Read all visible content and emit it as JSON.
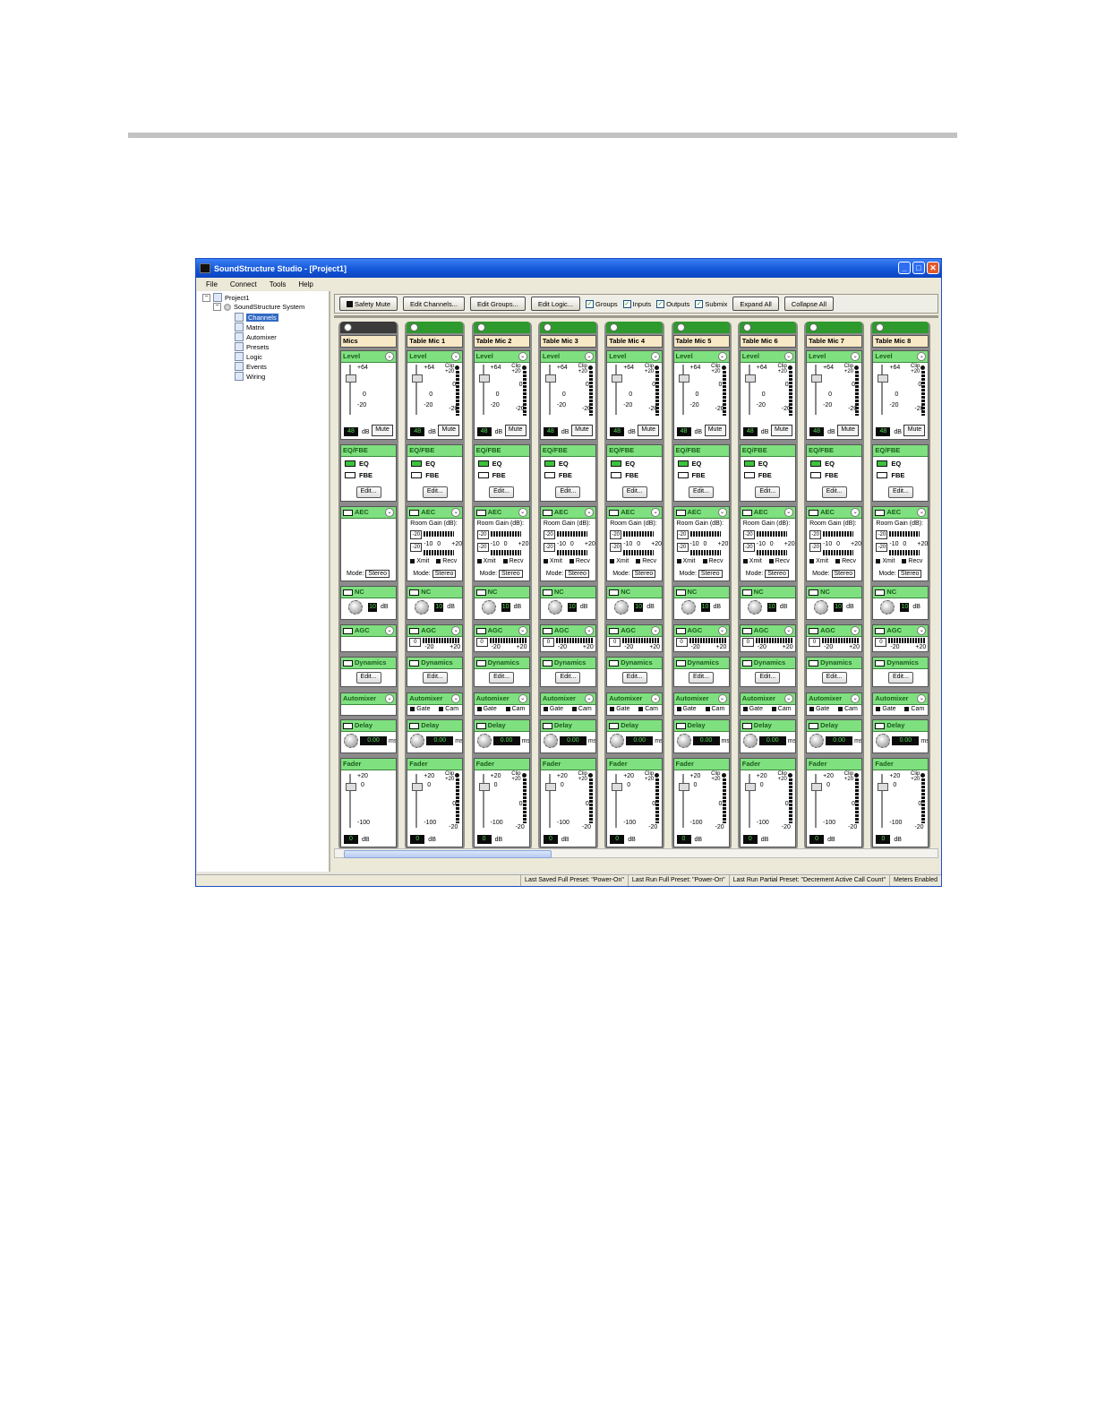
{
  "window": {
    "title": "SoundStructure Studio - [Project1]",
    "controls": [
      "_",
      "□",
      "✕"
    ]
  },
  "menu": [
    "File",
    "Connect",
    "Tools",
    "Help"
  ],
  "tree": {
    "root": "Project1",
    "system": "SoundStructure System",
    "items": [
      "Channels",
      "Matrix",
      "Automixer",
      "Presets",
      "Logic",
      "Events",
      "Wiring"
    ],
    "selected": "Channels"
  },
  "toolbar": {
    "safety_mute": "Safety Mute",
    "edit_channels": "Edit Channels...",
    "edit_groups": "Edit Groups...",
    "edit_logic": "Edit Logic...",
    "checks": [
      {
        "label": "Groups",
        "checked": true
      },
      {
        "label": "Inputs",
        "checked": true
      },
      {
        "label": "Outputs",
        "checked": true
      },
      {
        "label": "Submix",
        "checked": true
      }
    ],
    "expand_all": "Expand All",
    "collapse_all": "Collapse All"
  },
  "labels": {
    "level": "Level",
    "eqfbe": "EQ/FBE",
    "eq": "EQ",
    "fbe": "FBE",
    "edit": "Edit...",
    "aec": "AEC",
    "room_gain": "Room Gain (dB):",
    "xmit": "Xmit",
    "recv": "Recv",
    "mode": "Mode:",
    "stereo": "Stereo",
    "nc": "NC",
    "agc": "AGC",
    "dynamics": "Dynamics",
    "automixer": "Automixer",
    "gate": "Gate",
    "cam": "Cam",
    "delay": "Delay",
    "fader": "Fader",
    "mute": "Mute",
    "db": "dB",
    "ms": "ms",
    "clip": "Clip",
    "plus64": "+64",
    "zero": "0",
    "minus20": "-20",
    "plus20": "+20",
    "minus10": "-10",
    "minus100": "-100",
    "level_value": "48",
    "nc_value": "10",
    "delay_value": "0.00",
    "fader_value": "0",
    "agc_min": "-20",
    "agc_max": "+20",
    "agc_value": "0",
    "aec_box": "-20"
  },
  "strips": [
    {
      "name": "Mics",
      "group": true
    },
    {
      "name": "Table Mic 1"
    },
    {
      "name": "Table Mic 2"
    },
    {
      "name": "Table Mic 3"
    },
    {
      "name": "Table Mic 4"
    },
    {
      "name": "Table Mic 5"
    },
    {
      "name": "Table Mic 6"
    },
    {
      "name": "Table Mic 7"
    },
    {
      "name": "Table Mic 8"
    }
  ],
  "status": [
    "Last Saved Full Preset: \"Power-On\"",
    "Last Run Full Preset: \"Power-On\"",
    "Last Run Partial Preset: \"Decrement Active Call Count\"",
    "Meters Enabled"
  ],
  "colors": {
    "accent": "#2e9a2e",
    "block_header": "#7fe07f",
    "name_bg": "#f8e9c6",
    "title": "#1457d9"
  }
}
